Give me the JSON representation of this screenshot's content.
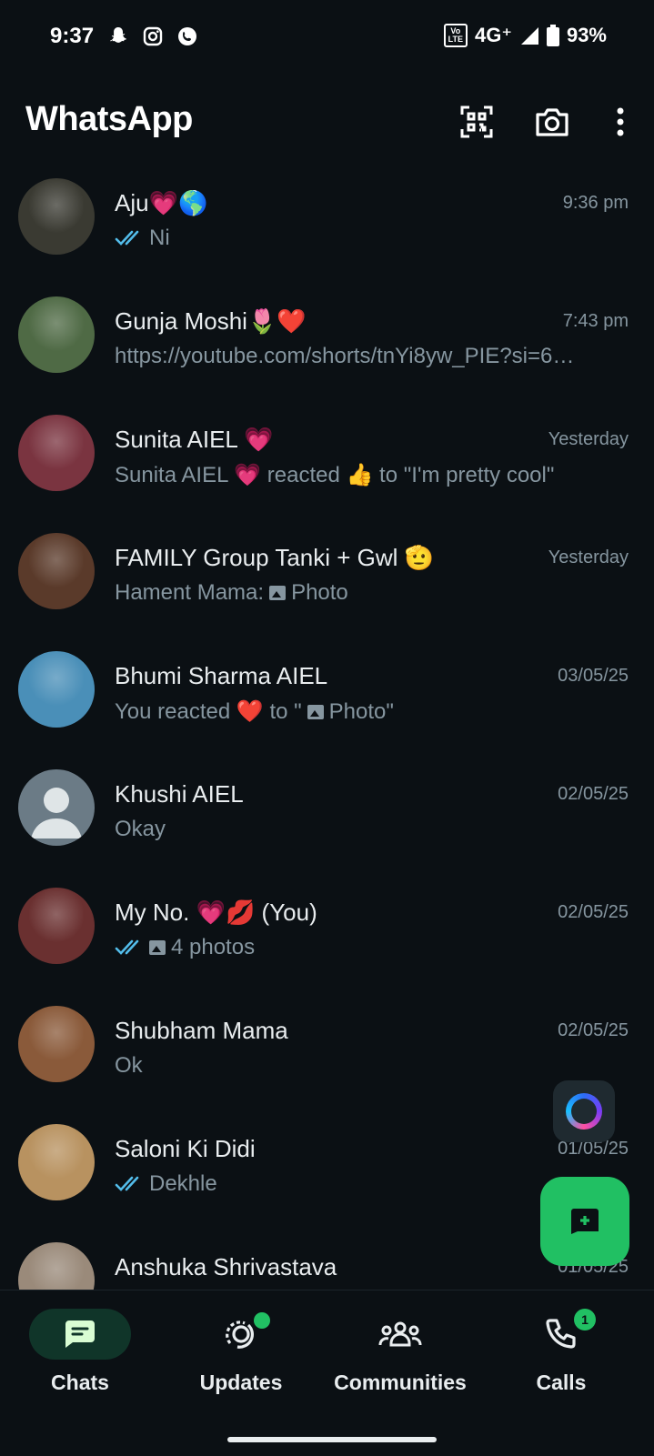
{
  "status_bar": {
    "time": "9:37",
    "network": "4G⁺",
    "volte": "Vo\nLTE",
    "battery": "93%"
  },
  "header": {
    "title": "WhatsApp"
  },
  "chats": [
    {
      "name": "Aju💗🌎",
      "time": "9:36 pm",
      "preview": "Ni",
      "ticks": true,
      "photo": false,
      "avatar_color": "#3a3a32"
    },
    {
      "name": "Gunja Moshi🌷❤️",
      "time": "7:43 pm",
      "preview": "https://youtube.com/shorts/tnYi8yw_PIE?si=6…",
      "ticks": false,
      "photo": false,
      "avatar_color": "#4f6a45"
    },
    {
      "name": "Sunita AIEL 💗",
      "time": "Yesterday",
      "preview": "Sunita AIEL 💗 reacted 👍 to \"I'm pretty cool\"",
      "ticks": false,
      "photo": false,
      "avatar_color": "#7a3440"
    },
    {
      "name": "FAMILY Group Tanki + Gwl 🫡",
      "time": "Yesterday",
      "preview_prefix": "Hament Mama:",
      "preview": "Photo",
      "ticks": false,
      "photo": true,
      "avatar_color": "#5a3a2a"
    },
    {
      "name": "Bhumi Sharma AIEL",
      "time": "03/05/25",
      "preview": "You reacted ❤️ to \"",
      "preview_suffix": "Photo\"",
      "ticks": false,
      "photo": true,
      "avatar_color": "#4a8fb8"
    },
    {
      "name": "Khushi AIEL",
      "time": "02/05/25",
      "preview": "Okay",
      "ticks": false,
      "photo": false,
      "avatar_color": "#6b7b86",
      "default_avatar": true
    },
    {
      "name": "My No. 💗💋 (You)",
      "time": "02/05/25",
      "preview": "4 photos",
      "ticks": true,
      "photo": true,
      "avatar_color": "#6a3030"
    },
    {
      "name": "Shubham Mama",
      "time": "02/05/25",
      "preview": "Ok",
      "ticks": false,
      "photo": false,
      "avatar_color": "#8a5a3a"
    },
    {
      "name": "Saloni Ki Didi",
      "time": "01/05/25",
      "preview": "Dekhle",
      "ticks": true,
      "photo": false,
      "avatar_color": "#b89260"
    },
    {
      "name": "Anshuka Shrivastava",
      "time": "01/05/25",
      "preview": "",
      "ticks": false,
      "photo": false,
      "avatar_color": "#9a8a7a"
    }
  ],
  "nav": {
    "chats": "Chats",
    "updates": "Updates",
    "communities": "Communities",
    "calls": "Calls",
    "calls_badge": "1"
  },
  "colors": {
    "accent": "#21c063",
    "background": "#0b1014",
    "secondary_text": "#8696a0",
    "read_ticks": "#53bdeb"
  }
}
